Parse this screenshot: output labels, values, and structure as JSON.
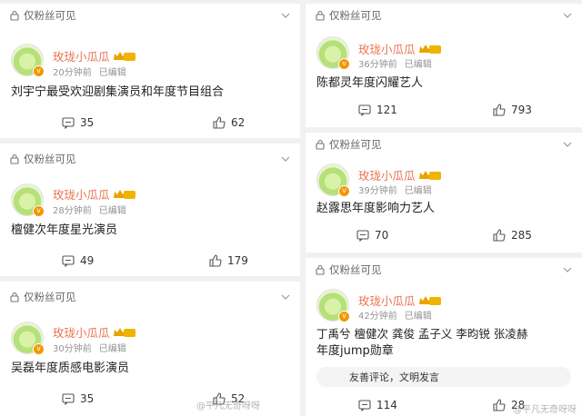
{
  "visibility_label": "仅粉丝可见",
  "author": "玫珑小瓜瓜",
  "level_badge": "II",
  "edited_label": "已编辑",
  "colors": {
    "username": "#eb7350",
    "badge": "#f39800"
  },
  "left_posts": [
    {
      "time": "20分钟前",
      "content": "刘宇宁最受欢迎剧集演员和年度节目组合",
      "comments": "35",
      "likes": "62"
    },
    {
      "time": "28分钟前",
      "content": "檀健次年度星光演员",
      "comments": "49",
      "likes": "179"
    },
    {
      "time": "30分钟前",
      "content": "吴磊年度质感电影演员",
      "comments": "35",
      "likes": "52"
    }
  ],
  "right_posts": [
    {
      "time": "36分钟前",
      "content": "陈都灵年度闪耀艺人",
      "comments": "121",
      "likes": "793"
    },
    {
      "time": "39分钟前",
      "content": "赵露思年度影响力艺人",
      "comments": "70",
      "likes": "285"
    },
    {
      "time": "42分钟前",
      "content_line1": "丁禹兮 檀健次 龚俊  孟子义 李昀锐 张凌赫",
      "content_line2": "年度jump勋章",
      "comments": "114",
      "likes": "28"
    }
  ],
  "comment_placeholder": "友善评论，文明发言",
  "watermark_left": "@平凡无奇呀呀",
  "watermark_right": "@平凡无奇呀呀"
}
